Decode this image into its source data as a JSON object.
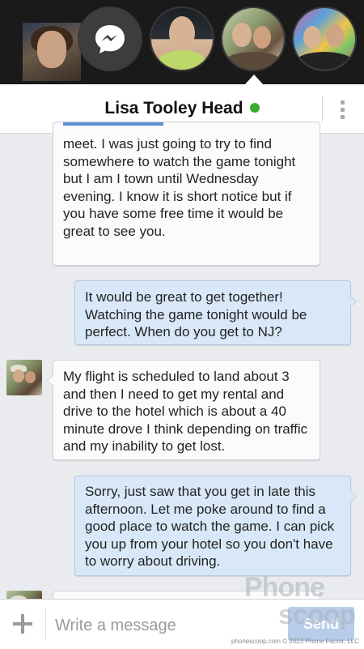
{
  "header": {
    "contact_name": "Lisa Tooley Head",
    "online_status_color": "#3aae2c"
  },
  "chat_heads": [
    {
      "name": "profile-photo-mustache-man"
    },
    {
      "name": "messenger-icon"
    },
    {
      "name": "profile-photo-smiling-man"
    },
    {
      "name": "profile-photo-couple-active"
    },
    {
      "name": "profile-photo-couple-colorful"
    }
  ],
  "messages": [
    {
      "direction": "incoming",
      "text": "meet. I was just going to try to find somewhere to watch the game tonight but I am I town until Wednesday evening. I know it is short notice but if you have some free time it would be great to see you."
    },
    {
      "direction": "outgoing",
      "text": "It would be great to get together! Watching the game tonight would be perfect. When do you get to NJ?"
    },
    {
      "direction": "incoming",
      "text": "My flight is scheduled to land about 3 and then I need to get my rental and drive to the hotel which is about a 40 minute drove I think depending on traffic and my inability to get lost."
    },
    {
      "direction": "outgoing",
      "text": "Sorry, just saw that you get in late this afternoon. Let me poke around to find a good place to watch the game. I can pick you up from your hotel so you don't have to worry about driving."
    }
  ],
  "composer": {
    "placeholder": "Write a message",
    "send_label": "Send"
  },
  "watermark": {
    "brand_top": "Phone",
    "brand_bottom": "scoop",
    "credit": "phonescoop.com  © 2023 Phone Factor, LLC"
  },
  "colors": {
    "incoming_bubble": "#fbfbfb",
    "outgoing_bubble": "#d9e8f8",
    "send_button": "#b7cdea",
    "background": "#e9ebee"
  }
}
